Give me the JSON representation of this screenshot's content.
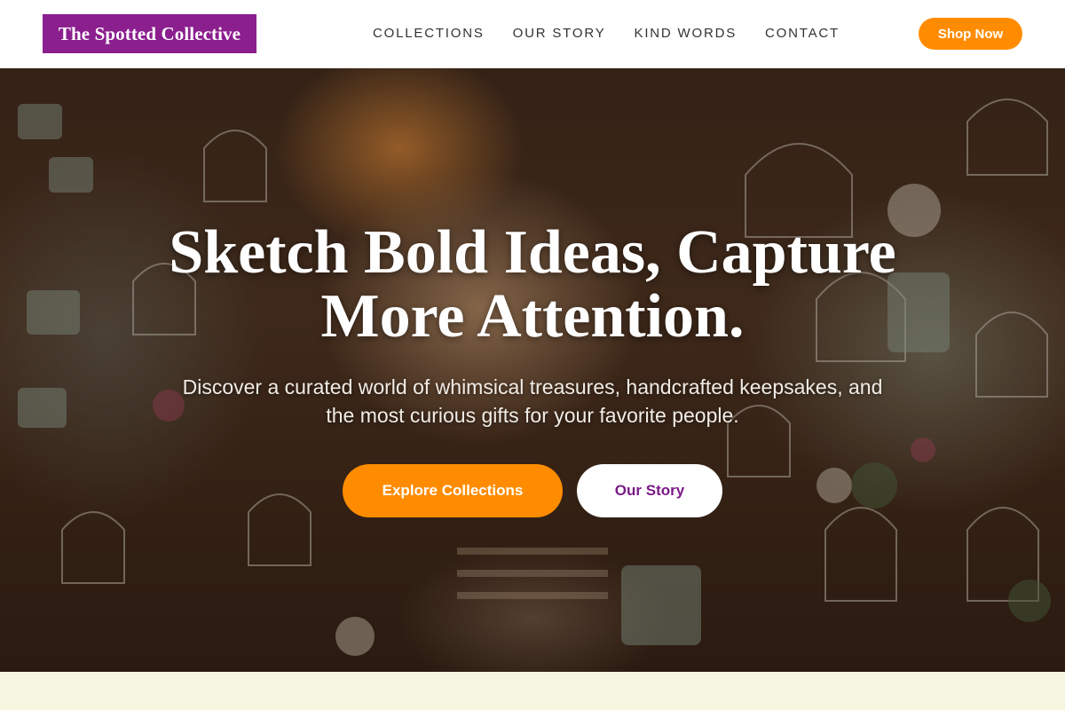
{
  "header": {
    "logo": "The Spotted Collective",
    "nav": [
      "COLLECTIONS",
      "OUR STORY",
      "KIND WORDS",
      "CONTACT"
    ],
    "cta": "Shop Now"
  },
  "hero": {
    "title_line1": "Sketch Bold Ideas, Capture",
    "title_line2": "More Attention.",
    "subtitle_line1": "Discover a curated world of whimsical treasures, handcrafted keepsakes, and",
    "subtitle_line2": "the most curious gifts for your favorite people.",
    "primary_button": "Explore Collections",
    "secondary_button": "Our Story"
  },
  "colors": {
    "brand_purple": "#8b1f8e",
    "accent_orange": "#ff8c00",
    "section_cream": "#f6f5e0"
  }
}
